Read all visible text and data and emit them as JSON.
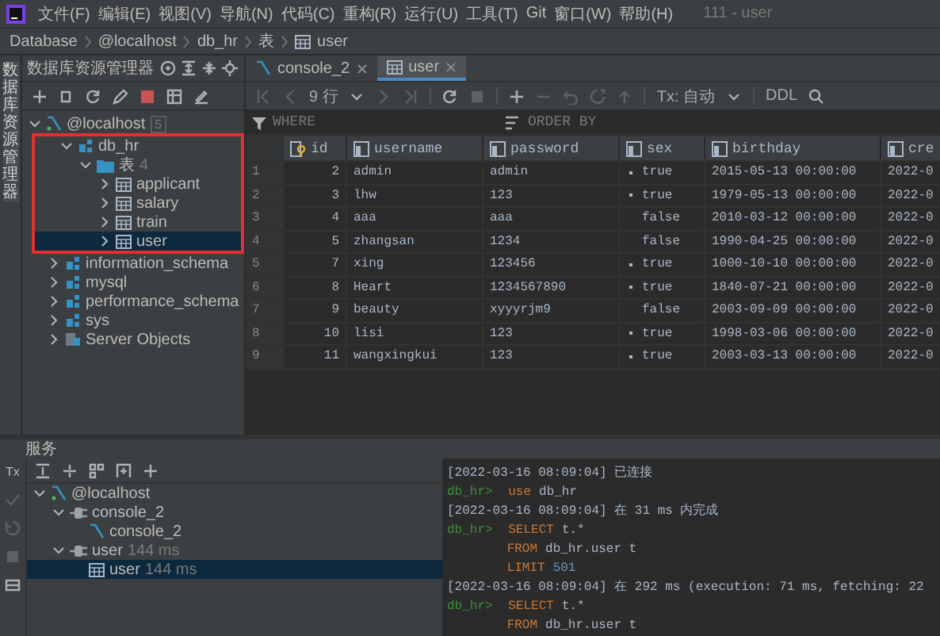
{
  "menu": {
    "items": [
      "文件(F)",
      "编辑(E)",
      "视图(V)",
      "导航(N)",
      "代码(C)",
      "重构(R)",
      "运行(U)",
      "工具(T)",
      "Git",
      "窗口(W)",
      "帮助(H)"
    ],
    "title": "111 - user"
  },
  "breadcrumb": [
    {
      "text": "Database",
      "kind": "plain"
    },
    {
      "text": "@localhost",
      "kind": "plain"
    },
    {
      "text": "db_hr",
      "kind": "plain"
    },
    {
      "text": "表",
      "kind": "plain"
    },
    {
      "text": "user",
      "kind": "table"
    }
  ],
  "side_strip": {
    "label": "数据库资源管理器"
  },
  "explorer": {
    "title": "数据库资源管理器",
    "tree": [
      {
        "label": "@localhost",
        "kind": "host",
        "badge": "5",
        "expanded": true,
        "selected": false,
        "children": [
          {
            "label": "db_hr",
            "kind": "schema",
            "expanded": true,
            "selected": false,
            "highlighted": true,
            "children": [
              {
                "label": "表",
                "kind": "folder",
                "count": "4",
                "expanded": true,
                "selected": false,
                "children": [
                  {
                    "label": "applicant",
                    "kind": "table",
                    "expanded": false,
                    "selected": false
                  },
                  {
                    "label": "salary",
                    "kind": "table",
                    "expanded": false,
                    "selected": false
                  },
                  {
                    "label": "train",
                    "kind": "table",
                    "expanded": false,
                    "selected": false
                  },
                  {
                    "label": "user",
                    "kind": "table",
                    "expanded": false,
                    "selected": true
                  }
                ]
              }
            ]
          },
          {
            "label": "information_schema",
            "kind": "schema",
            "expanded": false,
            "selected": false,
            "highlighted": false
          },
          {
            "label": "mysql",
            "kind": "schema",
            "expanded": false,
            "selected": false,
            "highlighted": false
          },
          {
            "label": "performance_schema",
            "kind": "schema",
            "expanded": false,
            "selected": false,
            "highlighted": false
          },
          {
            "label": "sys",
            "kind": "schema",
            "expanded": false,
            "selected": false,
            "highlighted": false
          },
          {
            "label": "Server Objects",
            "kind": "server",
            "expanded": false,
            "selected": false,
            "highlighted": false
          }
        ]
      }
    ]
  },
  "editor": {
    "tabs": [
      {
        "label": "console_2",
        "kind": "console",
        "selected": false
      },
      {
        "label": "user",
        "kind": "table",
        "selected": true
      }
    ],
    "toolbar": {
      "page_size": "9 行",
      "tx": "Tx: 自动",
      "ddl": "DDL"
    },
    "filter": {
      "where": "WHERE",
      "order_by": "ORDER BY"
    },
    "table": {
      "columns": [
        {
          "label": "id",
          "kind": "key"
        },
        {
          "label": "username",
          "kind": "column"
        },
        {
          "label": "password",
          "kind": "column"
        },
        {
          "label": "sex",
          "kind": "column"
        },
        {
          "label": "birthday",
          "kind": "column"
        },
        {
          "label": "cre",
          "kind": "column"
        }
      ],
      "rows": [
        {
          "num": "1",
          "id": "2",
          "username": "admin",
          "password": "admin",
          "sex": "true",
          "sex_dot": true,
          "birthday": "2015-05-13 00:00:00",
          "column_6": "2022-0"
        },
        {
          "num": "2",
          "id": "3",
          "username": "lhw",
          "password": "123",
          "sex": "true",
          "sex_dot": true,
          "birthday": "1979-05-13 00:00:00",
          "column_6": "2022-0"
        },
        {
          "num": "3",
          "id": "4",
          "username": "aaa",
          "password": "aaa",
          "sex": "false",
          "sex_dot": false,
          "birthday": "2010-03-12 00:00:00",
          "column_6": "2022-0"
        },
        {
          "num": "4",
          "id": "5",
          "username": "zhangsan",
          "password": "1234",
          "sex": "false",
          "sex_dot": false,
          "birthday": "1990-04-25 00:00:00",
          "column_6": "2022-0"
        },
        {
          "num": "5",
          "id": "7",
          "username": "xing",
          "password": "123456",
          "sex": "true",
          "sex_dot": true,
          "birthday": "1000-10-10 00:00:00",
          "column_6": "2022-0"
        },
        {
          "num": "6",
          "id": "8",
          "username": "Heart",
          "password": "1234567890",
          "sex": "true",
          "sex_dot": true,
          "birthday": "1840-07-21 00:00:00",
          "column_6": "2022-0"
        },
        {
          "num": "7",
          "id": "9",
          "username": "beauty",
          "password": "xyyyrjm9",
          "sex": "false",
          "sex_dot": false,
          "birthday": "2003-09-09 00:00:00",
          "column_6": "2022-0"
        },
        {
          "num": "8",
          "id": "10",
          "username": "lisi",
          "password": "123",
          "sex": "true",
          "sex_dot": true,
          "birthday": "1998-03-06 00:00:00",
          "column_6": "2022-0"
        },
        {
          "num": "9",
          "id": "11",
          "username": "wangxingkui",
          "password": "123",
          "sex": "true",
          "sex_dot": true,
          "birthday": "2003-03-13 00:00:00",
          "column_6": "2022-0"
        }
      ]
    }
  },
  "services": {
    "title": "服务",
    "tx_label": "Tx",
    "tree": [
      {
        "label": "@localhost",
        "kind": "host",
        "expanded": true,
        "selected": false,
        "children": [
          {
            "label": "console_2",
            "kind": "session",
            "expanded": true,
            "selected": false,
            "children": [
              {
                "label": "console_2",
                "kind": "console",
                "selected": false
              }
            ]
          },
          {
            "label": "user",
            "kind": "session",
            "time": "144 ms",
            "expanded": true,
            "selected": false,
            "children": [
              {
                "label": "user",
                "kind": "table",
                "time": "144 ms",
                "selected": true
              }
            ]
          }
        ]
      }
    ]
  },
  "console": {
    "lines": [
      {
        "kind": "log",
        "text": "[2022-03-16 08:09:04] 已连接"
      },
      {
        "kind": "command",
        "prompt": "db_hr>",
        "parts": [
          {
            "kind": "keyword",
            "text": "use"
          },
          {
            "kind": "plain",
            "text": "db_hr"
          }
        ]
      },
      {
        "kind": "log",
        "text": "[2022-03-16 08:09:04] 在 31 ms 内完成"
      },
      {
        "kind": "command",
        "prompt": "db_hr>",
        "parts": [
          {
            "kind": "keyword",
            "text": "SELECT"
          },
          {
            "kind": "plain",
            "text": "t.*"
          }
        ]
      },
      {
        "kind": "continuation",
        "parts": [
          {
            "kind": "keyword",
            "text": "FROM"
          },
          {
            "kind": "plain",
            "text": "db_hr.user t"
          }
        ]
      },
      {
        "kind": "continuation",
        "parts": [
          {
            "kind": "keyword",
            "text": "LIMIT"
          },
          {
            "kind": "number",
            "text": "501"
          }
        ]
      },
      {
        "kind": "log",
        "text": "[2022-03-16 08:09:04] 在 292 ms (execution: 71 ms, fetching: 22"
      },
      {
        "kind": "command",
        "prompt": "db_hr>",
        "parts": [
          {
            "kind": "keyword",
            "text": "SELECT"
          },
          {
            "kind": "plain",
            "text": "t.*"
          }
        ]
      },
      {
        "kind": "continuation",
        "parts": [
          {
            "kind": "keyword",
            "text": "FROM"
          },
          {
            "kind": "plain",
            "text": "db_hr.user t"
          }
        ]
      }
    ]
  }
}
